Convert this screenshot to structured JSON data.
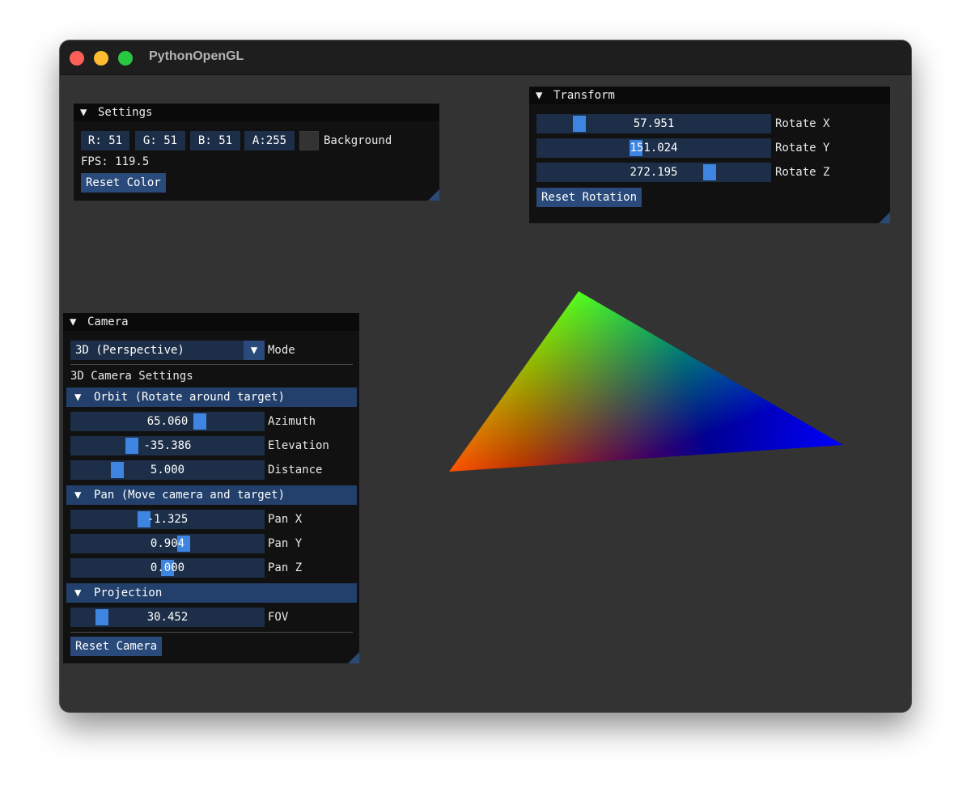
{
  "window": {
    "title": "PythonOpenGL"
  },
  "settings": {
    "header": "Settings",
    "r": "R: 51",
    "g": "G: 51",
    "b": "B: 51",
    "a": "A:255",
    "background_label": "Background",
    "fps": "FPS: 119.5",
    "reset_color": "Reset Color",
    "background_color": "#333333"
  },
  "transform": {
    "header": "Transform",
    "rotate_x": {
      "value": "57.951",
      "label": "Rotate X",
      "fraction": 0.161
    },
    "rotate_y": {
      "value": "151.024",
      "label": "Rotate Y",
      "fraction": 0.42
    },
    "rotate_z": {
      "value": "272.195",
      "label": "Rotate Z",
      "fraction": 0.756
    },
    "reset_rotation": "Reset Rotation"
  },
  "camera": {
    "header": "Camera",
    "mode_value": "3D (Perspective)",
    "mode_label": "Mode",
    "settings_heading": "3D Camera Settings",
    "orbit": {
      "header": "Orbit (Rotate around target)",
      "azimuth": {
        "value": "65.060",
        "label": "Azimuth",
        "fraction": 0.68
      },
      "elevation": {
        "value": "-35.386",
        "label": "Elevation",
        "fraction": 0.3
      },
      "distance": {
        "value": "5.000",
        "label": "Distance",
        "fraction": 0.22
      }
    },
    "pan": {
      "header": "Pan (Move camera and target)",
      "pan_x": {
        "value": "-1.325",
        "label": "Pan X",
        "fraction": 0.37
      },
      "pan_y": {
        "value": "0.904",
        "label": "Pan Y",
        "fraction": 0.59
      },
      "pan_z": {
        "value": "0.000",
        "label": "Pan Z",
        "fraction": 0.5
      }
    },
    "projection": {
      "header": "Projection",
      "fov": {
        "value": "30.452",
        "label": "FOV",
        "fraction": 0.13
      }
    },
    "reset_camera": "Reset Camera"
  },
  "icons": {
    "collapse_arrow": "▼"
  },
  "colors": {
    "accent": "#3d85e0",
    "frame_bg": "#1d2f48",
    "button": "#294a7a",
    "header_section": "#22406b",
    "viewport_bg": "#333333"
  },
  "scene": {
    "triangle_vertex_colors": [
      "#ff0000",
      "#00ff00",
      "#0000ff"
    ]
  }
}
